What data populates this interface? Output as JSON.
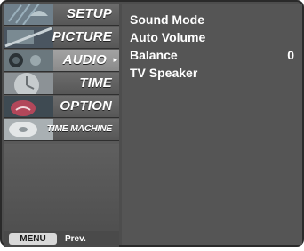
{
  "sidebar": {
    "items": [
      {
        "label": "SETUP",
        "selected": false
      },
      {
        "label": "PICTURE",
        "selected": false
      },
      {
        "label": "AUDIO",
        "selected": true
      },
      {
        "label": "TIME",
        "selected": false
      },
      {
        "label": "OPTION",
        "selected": false
      },
      {
        "label": "TIME MACHINE",
        "selected": false
      }
    ],
    "selected_arrow": "▸"
  },
  "footer": {
    "menu_key": "MENU",
    "prev_label": "Prev."
  },
  "audio_menu": {
    "options": [
      {
        "label": "Sound Mode",
        "value": ""
      },
      {
        "label": "Auto Volume",
        "value": ""
      },
      {
        "label": "Balance",
        "value": "0"
      },
      {
        "label": "TV Speaker",
        "value": ""
      }
    ]
  },
  "icons": {
    "setup": "satellite-dish-icon",
    "picture": "film-strip-icon",
    "audio": "speaker-icon",
    "time": "clock-icon",
    "option": "special-tag-icon",
    "time_machine": "time-machine-disc-icon"
  },
  "colors": {
    "panel": "#555555",
    "sidebar": "#5a5a5a",
    "selected_item": "#959595",
    "text": "#ffffff"
  }
}
